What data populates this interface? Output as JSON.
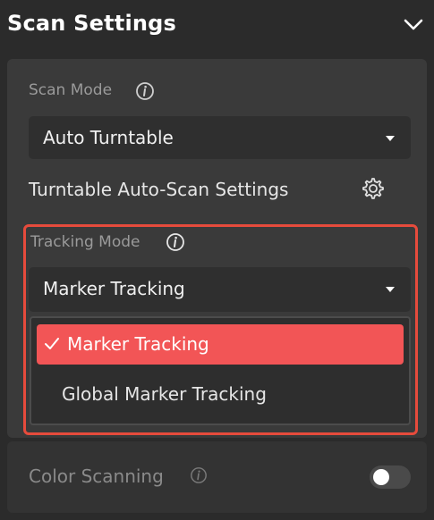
{
  "section": {
    "title": "Scan Settings"
  },
  "scan_mode": {
    "label": "Scan Mode",
    "value": "Auto Turntable"
  },
  "turntable": {
    "label": "Turntable Auto-Scan Settings"
  },
  "tracking_mode": {
    "label": "Tracking Mode",
    "value": "Marker Tracking",
    "options": [
      {
        "label": "Marker Tracking",
        "selected": true
      },
      {
        "label": "Global Marker Tracking",
        "selected": false
      }
    ]
  },
  "color_scanning": {
    "label": "Color Scanning",
    "enabled": false
  },
  "colors": {
    "highlight_border": "#e64b3c",
    "selected_option_bg": "#f25556"
  },
  "icons": [
    "chevron-down-icon",
    "info-icon",
    "gear-icon",
    "checkmark-icon",
    "caret-down-icon"
  ]
}
